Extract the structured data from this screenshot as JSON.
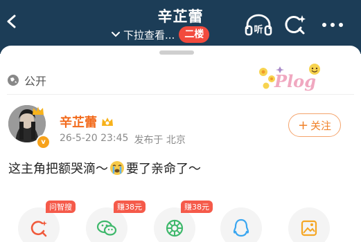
{
  "header": {
    "title": "辛芷蕾",
    "subtitle": "下拉查看...",
    "floor_badge": "二楼",
    "listen_label": "听"
  },
  "post": {
    "visibility": "公开",
    "sticker_text": "Plog",
    "author": "辛芷蕾",
    "avatar_badge": "v",
    "timestamp": "26-5-20 23:45",
    "location": "发布于 北京",
    "follow_label": "关注",
    "text_before_emoji": "这主角把额哭滴～",
    "text_after_emoji": "要了亲命了～"
  },
  "share": {
    "items": [
      {
        "icon": "search-ai-icon",
        "tag": "问智搜"
      },
      {
        "icon": "wechat-icon",
        "tag": "赚38元"
      },
      {
        "icon": "moments-icon",
        "tag": "赚38元"
      },
      {
        "icon": "qq-icon",
        "tag": ""
      },
      {
        "icon": "save-image-icon",
        "tag": ""
      }
    ]
  },
  "colors": {
    "header_bg": "#1c3d57",
    "accent_orange": "#f26b1d",
    "badge_red": "#f24a3d"
  }
}
